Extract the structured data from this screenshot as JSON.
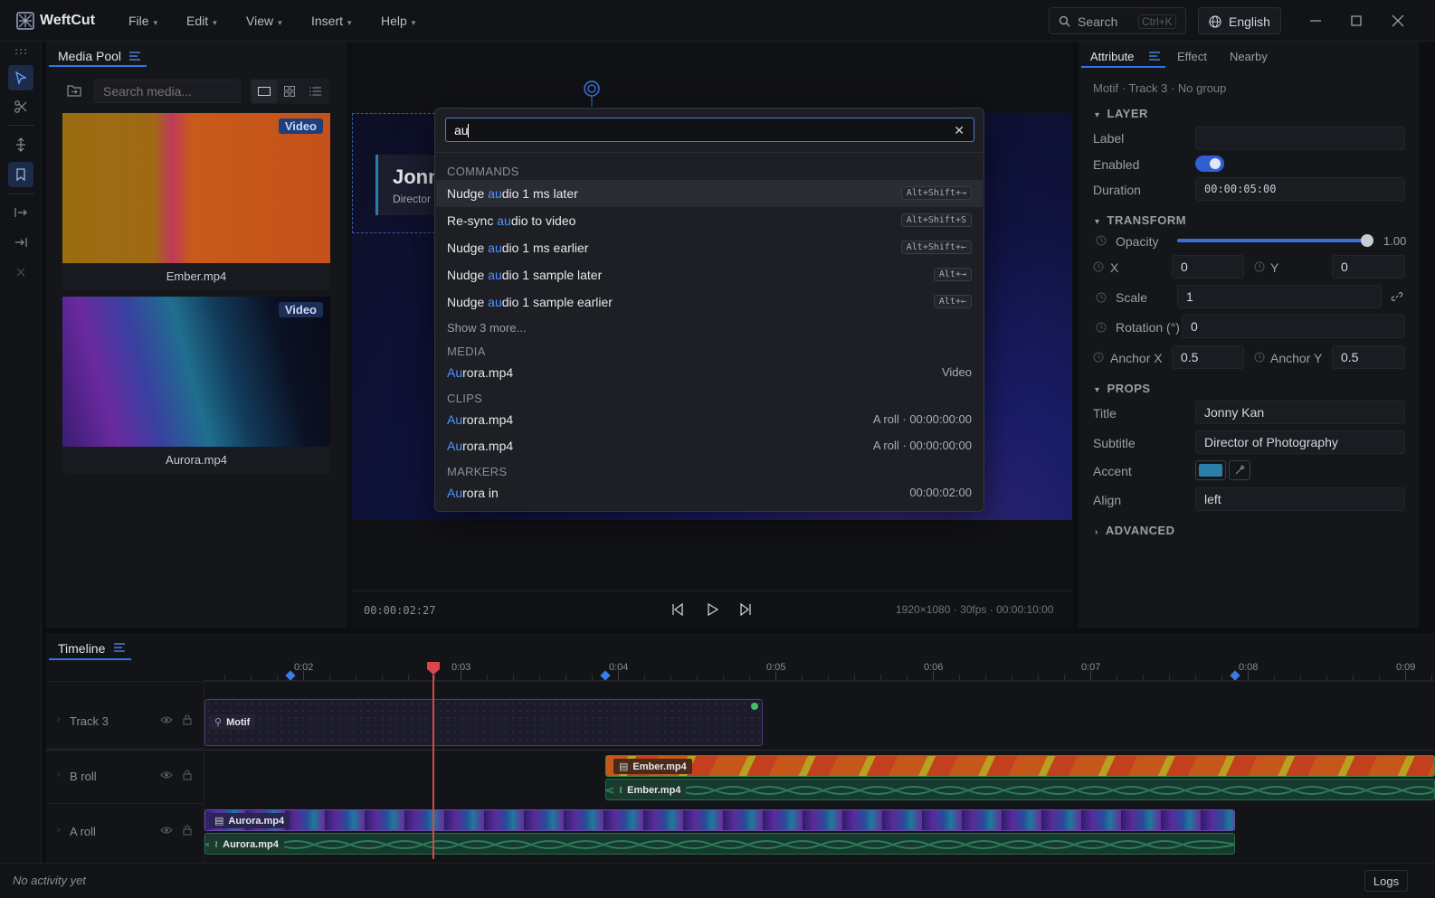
{
  "app": {
    "name": "WeftCut"
  },
  "menus": [
    {
      "label": "File"
    },
    {
      "label": "Edit"
    },
    {
      "label": "View"
    },
    {
      "label": "Insert"
    },
    {
      "label": "Help"
    }
  ],
  "search": {
    "label": "Search",
    "shortcut": "Ctrl+K"
  },
  "language": {
    "label": "English"
  },
  "media_pool": {
    "tab": "Media Pool",
    "search_placeholder": "Search media...",
    "items": [
      {
        "name": "Ember.mp4",
        "badge": "Video"
      },
      {
        "name": "Aurora.mp4",
        "badge": "Video"
      }
    ]
  },
  "viewer": {
    "overlay_title": "Jonny",
    "overlay_subtitle": "Director",
    "timecode": "00:00:02:27",
    "info": "1920×1080 · 30fps · 00:00:10:00"
  },
  "palette": {
    "query": "au",
    "sections": {
      "commands": "COMMANDS",
      "media": "MEDIA",
      "clips": "CLIPS",
      "markers": "MARKERS"
    },
    "commands": [
      {
        "pre": "Nudge ",
        "hl": "au",
        "post": "dio 1 ms later",
        "shortcut": "Alt+Shift+→"
      },
      {
        "pre": "Re-sync ",
        "hl": "au",
        "post": "dio to video",
        "shortcut": "Alt+Shift+S"
      },
      {
        "pre": "Nudge ",
        "hl": "au",
        "post": "dio 1 ms earlier",
        "shortcut": "Alt+Shift+←"
      },
      {
        "pre": "Nudge ",
        "hl": "au",
        "post": "dio 1 sample later",
        "shortcut": "Alt+→"
      },
      {
        "pre": "Nudge ",
        "hl": "au",
        "post": "dio 1 sample earlier",
        "shortcut": "Alt+←"
      }
    ],
    "more": "Show 3 more...",
    "media": [
      {
        "hl": "Au",
        "post": "rora.mp4",
        "meta": "Video"
      }
    ],
    "clips": [
      {
        "hl": "Au",
        "post": "rora.mp4",
        "meta": "A roll · 00:00:00:00"
      },
      {
        "hl": "Au",
        "post": "rora.mp4",
        "meta": "A roll · 00:00:00:00"
      }
    ],
    "markers": [
      {
        "hl": "Au",
        "post": "rora in",
        "meta": "00:00:02:00"
      }
    ]
  },
  "attribute": {
    "tabs": [
      "Attribute",
      "Effect",
      "Nearby"
    ],
    "breadcrumb": "Motif · Track 3 · No group",
    "layer": {
      "title": "LAYER",
      "label": "Label",
      "label_value": "",
      "enabled": "Enabled",
      "duration": "Duration",
      "duration_value": "00:00:05:00"
    },
    "transform": {
      "title": "TRANSFORM",
      "opacity": "Opacity",
      "opacity_value": "1.00",
      "opacity_level": 1.0,
      "x": "X",
      "x_value": "0",
      "y": "Y",
      "y_value": "0",
      "scale": "Scale",
      "scale_value": "1",
      "rotation": "Rotation (°)",
      "rotation_value": "0",
      "anchor_x": "Anchor X",
      "anchor_x_value": "0.5",
      "anchor_y": "Anchor Y",
      "anchor_y_value": "0.5"
    },
    "props": {
      "title": "PROPS",
      "title_label": "Title",
      "title_value": "Jonny Kan",
      "subtitle_label": "Subtitle",
      "subtitle_value": "Director of Photography",
      "accent_label": "Accent",
      "accent_color": "#2a7fa8",
      "align_label": "Align",
      "align_value": "left"
    },
    "advanced": {
      "title": "ADVANCED"
    }
  },
  "timeline": {
    "tab": "Timeline",
    "ruler": [
      "0:02",
      "0:03",
      "0:04",
      "0:05",
      "0:06",
      "0:07",
      "0:08",
      "0:09"
    ],
    "tracks": [
      {
        "name": "Track 3"
      },
      {
        "name": "B roll"
      },
      {
        "name": "A roll"
      }
    ],
    "clips": {
      "motif": "Motif",
      "ember_video": "Ember.mp4",
      "ember_audio": "Ember.mp4",
      "aurora_video": "Aurora.mp4",
      "aurora_audio": "Aurora.mp4"
    }
  },
  "status": {
    "text": "No activity yet",
    "logs": "Logs"
  }
}
